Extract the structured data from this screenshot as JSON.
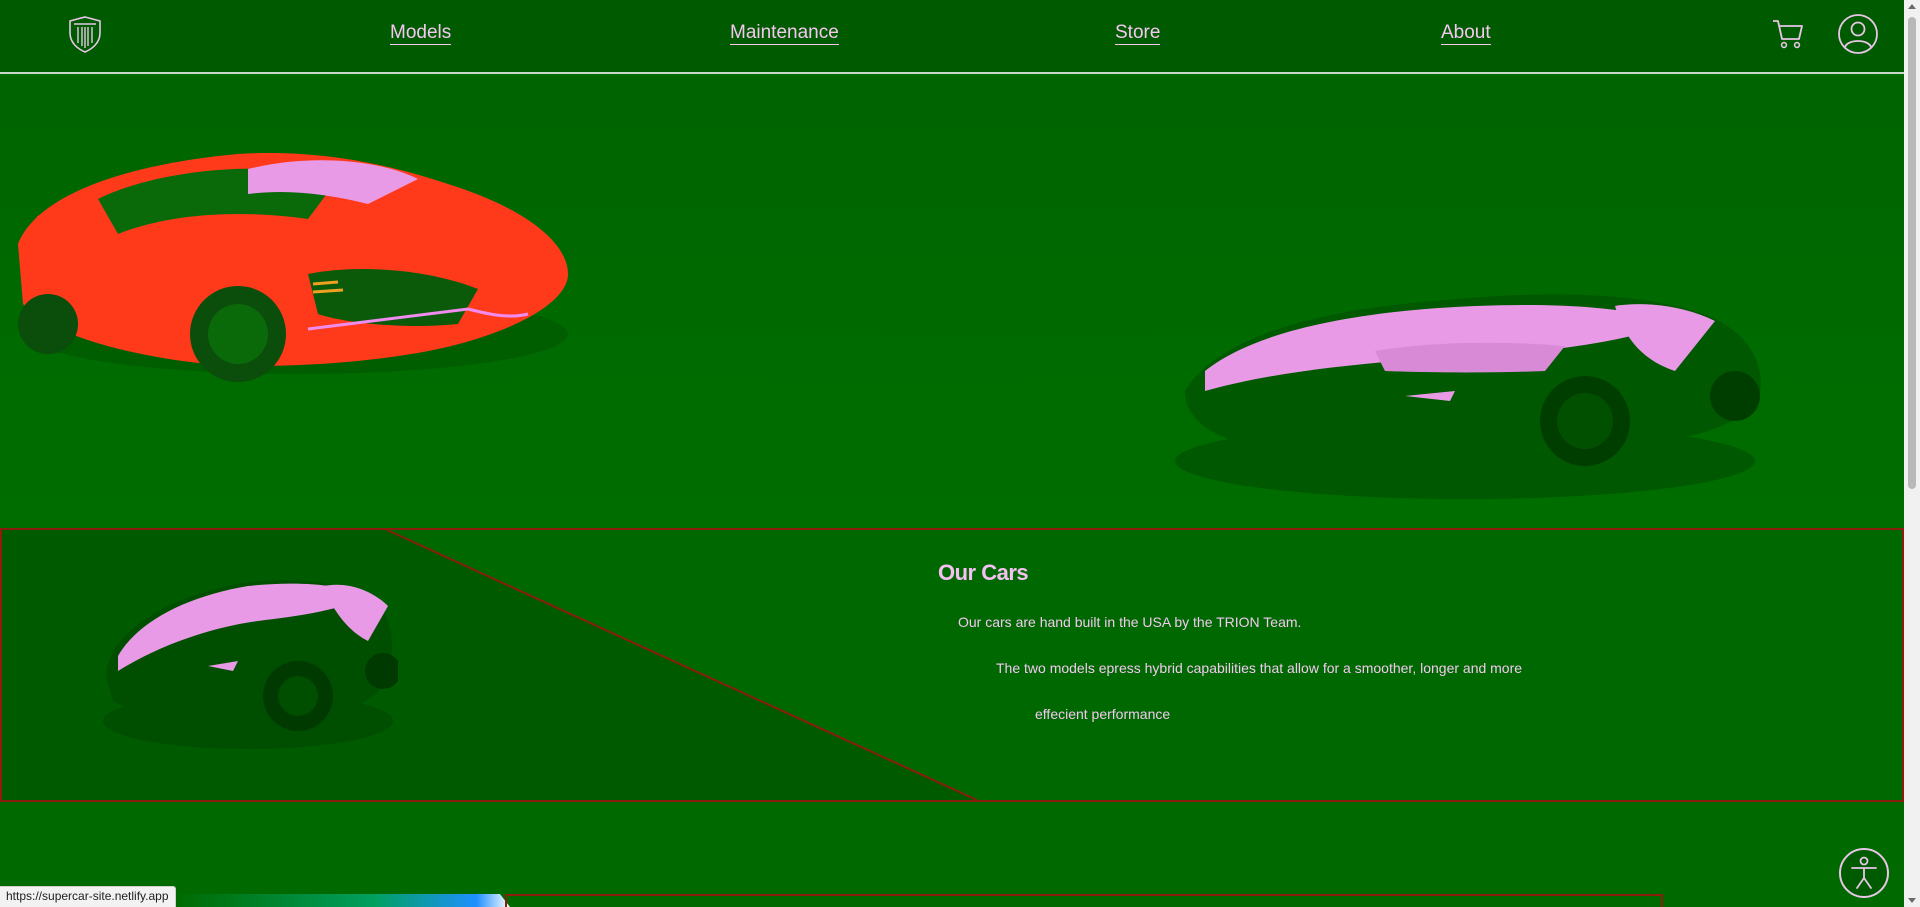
{
  "nav": {
    "logo_icon": "shield-icon",
    "links": [
      "Models",
      "Maintenance",
      "Store",
      "About"
    ],
    "cart_icon": "cart-icon",
    "account_icon": "account-icon"
  },
  "section": {
    "title": "Our Cars",
    "line1": "Our cars are hand built in the USA by the TRION Team.",
    "line2": "The two models epress hybrid capabilities that allow for a smoother, longer and more",
    "line3": "effecient performance"
  },
  "status_bar": {
    "url": "https://supercar-site.netlify.app"
  },
  "colors": {
    "background": "#006b00",
    "nav": "#005a00",
    "text": "#f3b9f0",
    "red_car": "#ff3a1a",
    "pink_car": "#e99ae6",
    "border_red": "#8a1d0d"
  },
  "icons": [
    "shield-icon",
    "cart-icon",
    "account-icon",
    "accessibility-icon"
  ]
}
